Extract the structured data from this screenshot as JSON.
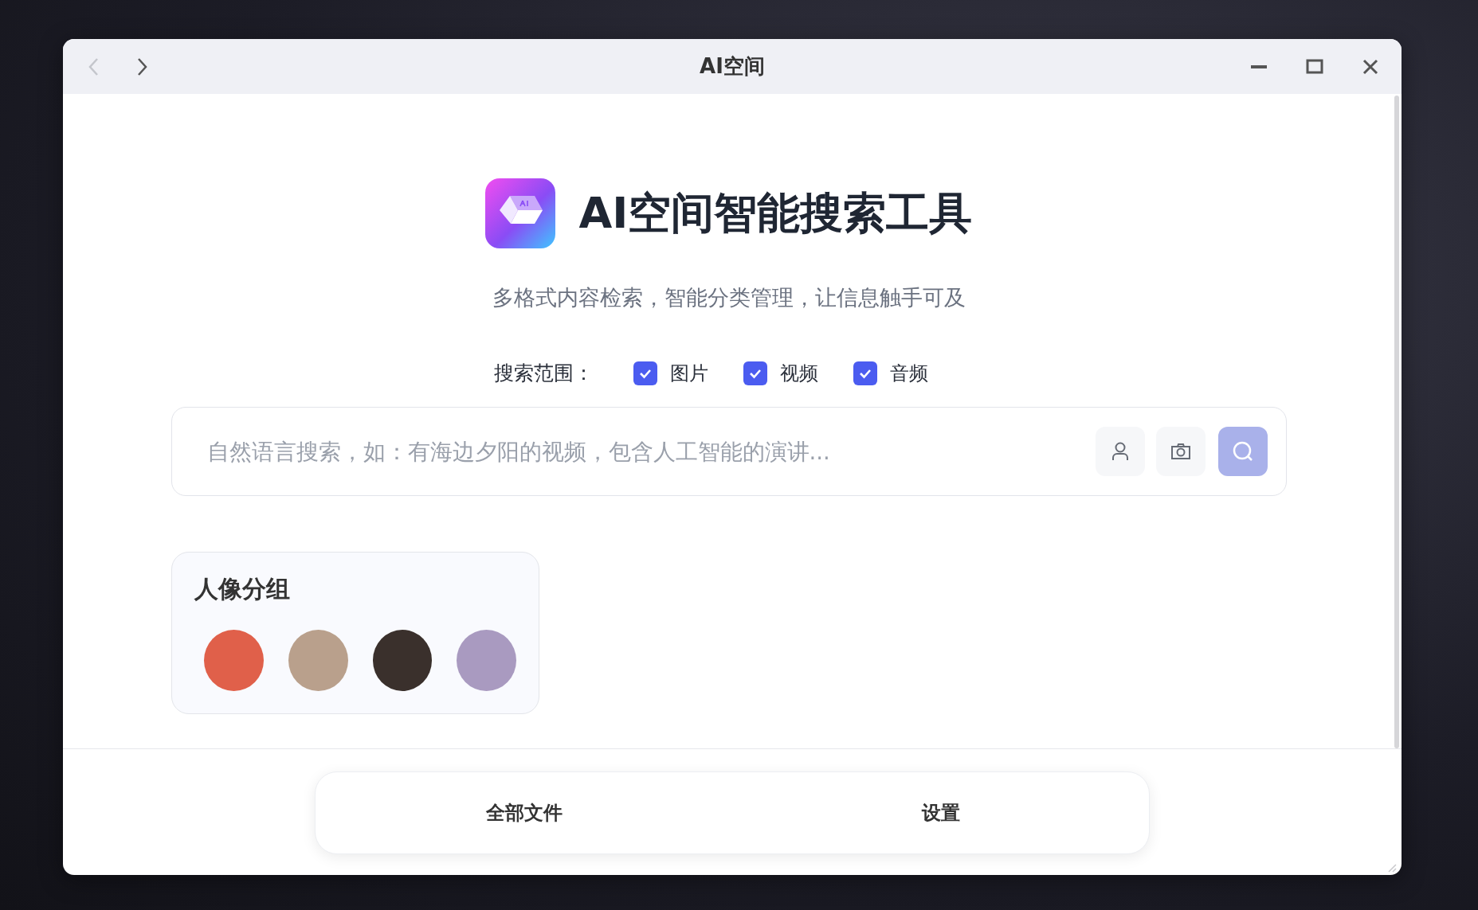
{
  "window": {
    "title": "AI空间",
    "back_disabled": true
  },
  "header": {
    "title": "AI空间智能搜索工具",
    "subtitle": "多格式内容检索，智能分类管理，让信息触手可及"
  },
  "scope": {
    "label": "搜索范围：",
    "options": [
      {
        "label": "图片",
        "checked": true
      },
      {
        "label": "视频",
        "checked": true
      },
      {
        "label": "音频",
        "checked": true
      }
    ]
  },
  "search": {
    "placeholder": "自然语言搜索，如：有海边夕阳的视频，包含人工智能的演讲..."
  },
  "portrait_group": {
    "title": "人像分组",
    "avatars": [
      {
        "color": "#e0604a"
      },
      {
        "color": "#b9a08c"
      },
      {
        "color": "#3a302c"
      },
      {
        "color": "#a99ac0"
      }
    ]
  },
  "bottom_nav": [
    {
      "label": "全部文件"
    },
    {
      "label": "设置"
    }
  ]
}
